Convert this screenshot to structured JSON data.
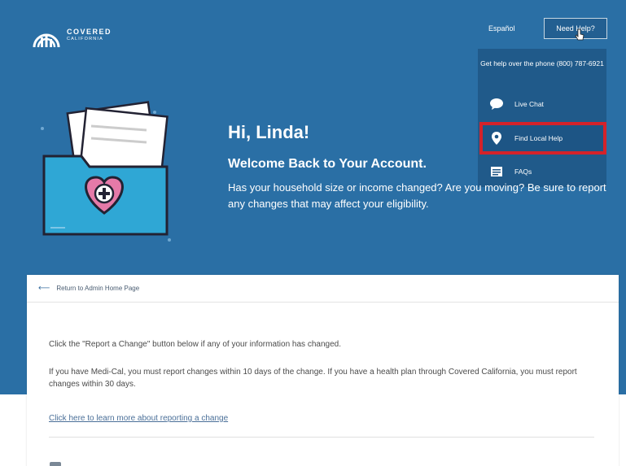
{
  "header": {
    "logo_line1": "COVERED",
    "logo_line2": "CALIFORNIA",
    "language_link": "Español",
    "help_button": "Need Help?"
  },
  "help_menu": {
    "phone_text": "Get help over the phone (800) 787-6921",
    "items": [
      {
        "label": "Live Chat",
        "icon": "chat-bubble-icon"
      },
      {
        "label": "Find Local Help",
        "icon": "map-pin-icon",
        "highlighted": true
      },
      {
        "label": "FAQs",
        "icon": "faq-icon"
      }
    ],
    "highlight_color": "#d4222a"
  },
  "hero": {
    "greeting": "Hi, Linda!",
    "welcome": "Welcome Back to Your Account.",
    "intro": "Has your household size or income changed? Are you moving? Be sure to report any changes that may affect your eligibility.",
    "background_color": "#2a6fa5"
  },
  "card": {
    "back_link": "Return to Admin Home Page",
    "instruction": "Click the \"Report a Change\" button below if any of your information has changed.",
    "medi_cal_note": "If you have Medi-Cal, you must report changes within 10 days of the change. If you have a health plan through Covered California, you must report changes within 30 days.",
    "learn_more_link": "Click here to learn more about reporting a change"
  }
}
